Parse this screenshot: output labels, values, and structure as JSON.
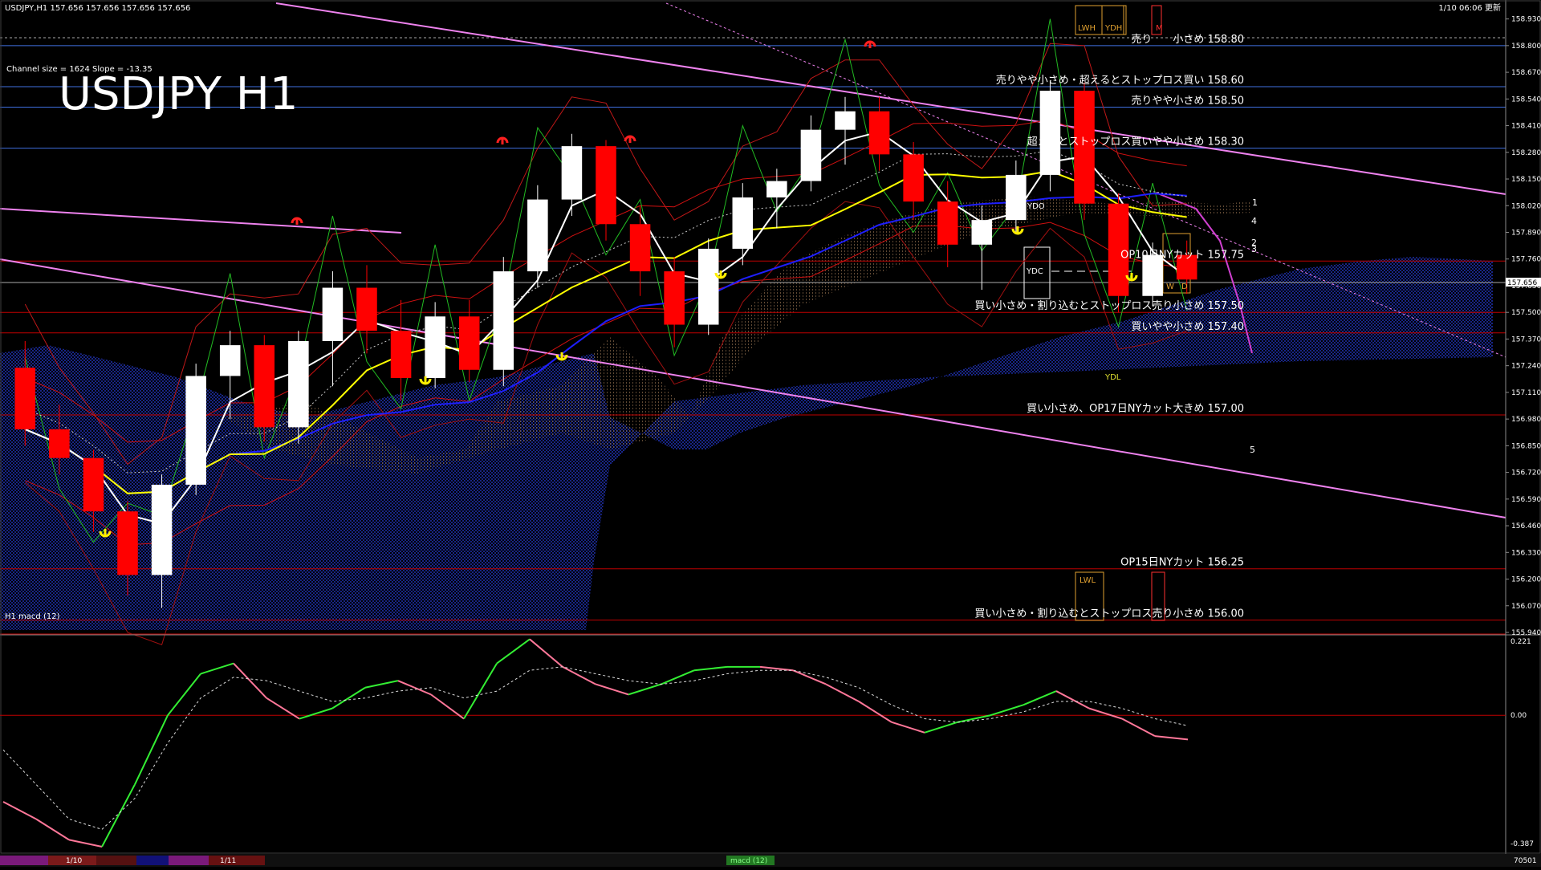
{
  "chart_header": "USDJPY,H1  157.656 157.656 157.656 157.656",
  "channel_info": "Channel size = 1624 Slope = -13.35",
  "big_title": "USDJPY H1",
  "update_time": "1/10 06:06 更新",
  "current_price": "157.656",
  "colors": {
    "background": "#000000",
    "bull_candle": "#ffffff",
    "bear_candle": "#ff0000",
    "ma_short": "#ffffff",
    "ma_mid": "#ffff00",
    "ma_long": "#1e1eff",
    "channel": "#ee82ee",
    "level_blue": "#3f6fdf",
    "level_red": "#c00000",
    "cloud_blue": "#1c2c9c",
    "cloud_brown": "#8a6a4a",
    "macd_up": "#33ee33",
    "macd_down": "#ff7799"
  },
  "annotations": [
    {
      "text": "売り　　小さめ 158.80",
      "price": 158.8
    },
    {
      "text": "売りやや小さめ・超えるとストップロス買い 158.60",
      "price": 158.6
    },
    {
      "text": "売りやや小さめ 158.50",
      "price": 158.5
    },
    {
      "text": "超えるとストップロス買いやや小さめ 158.30",
      "price": 158.3
    },
    {
      "text": "OP10日NYカット 157.75",
      "price": 157.75
    },
    {
      "text": "買い小さめ・割り込むとストップロス売り小さめ 157.50",
      "price": 157.5
    },
    {
      "text": "買いやや小さめ 157.40",
      "price": 157.4
    },
    {
      "text": "買い小さめ、OP17日NYカット大きめ 157.00",
      "price": 157.0
    },
    {
      "text": "OP15日NYカット 156.25",
      "price": 156.25
    },
    {
      "text": "買い小さめ・割り込むとストップロス売り小さめ 156.00",
      "price": 156.0
    }
  ],
  "box_labels": {
    "lwh": "LWH",
    "ydh": "YDH",
    "m": "M",
    "ydo": "YDO",
    "ydc": "YDC",
    "w": "W",
    "d": "D",
    "ydl": "YDL",
    "lwl": "LWL"
  },
  "channel_labels": [
    "1",
    "2",
    "3",
    "4",
    "5"
  ],
  "macd_label": "H1  macd (12)",
  "macd_axis": [
    "0.221",
    "0.00",
    "-0.387"
  ],
  "bottom_ticks": [
    "1/10",
    "1/11"
  ],
  "bottom_right": "70501",
  "bottom_tab": "macd (12)",
  "chart_data": [
    {
      "type": "candlestick",
      "title": "USDJPY H1",
      "ylim": [
        155.94,
        158.995
      ],
      "y_ticks": [
        "158.930",
        "158.800",
        "158.670",
        "158.540",
        "158.410",
        "158.280",
        "158.150",
        "158.020",
        "157.890",
        "157.760",
        "157.630",
        "157.500",
        "157.370",
        "157.240",
        "157.110",
        "156.980",
        "156.850",
        "156.720",
        "156.590",
        "156.460",
        "156.330",
        "156.200",
        "156.070",
        "155.940"
      ],
      "horizontal_levels": [
        158.8,
        158.6,
        158.5,
        158.3,
        157.75,
        157.5,
        157.4,
        157.0,
        156.25,
        156.0
      ],
      "candles_count": 178,
      "ohlc": [
        {
          "o": 157.23,
          "h": 157.36,
          "l": 156.85,
          "c": 156.93
        },
        {
          "o": 156.93,
          "h": 157.05,
          "l": 156.71,
          "c": 156.79
        },
        {
          "o": 156.79,
          "h": 156.83,
          "l": 156.43,
          "c": 156.53
        },
        {
          "o": 156.53,
          "h": 156.58,
          "l": 156.12,
          "c": 156.22
        },
        {
          "o": 156.22,
          "h": 156.71,
          "l": 156.06,
          "c": 156.66
        },
        {
          "o": 156.66,
          "h": 157.25,
          "l": 156.61,
          "c": 157.19
        },
        {
          "o": 157.19,
          "h": 157.41,
          "l": 156.98,
          "c": 157.34
        },
        {
          "o": 157.34,
          "h": 157.39,
          "l": 156.87,
          "c": 156.94
        },
        {
          "o": 156.94,
          "h": 157.41,
          "l": 156.86,
          "c": 157.36
        },
        {
          "o": 157.36,
          "h": 157.7,
          "l": 157.14,
          "c": 157.62
        },
        {
          "o": 157.62,
          "h": 157.73,
          "l": 157.3,
          "c": 157.41
        },
        {
          "o": 157.41,
          "h": 157.56,
          "l": 157.07,
          "c": 157.18
        },
        {
          "o": 157.18,
          "h": 157.55,
          "l": 157.13,
          "c": 157.48
        },
        {
          "o": 157.48,
          "h": 157.56,
          "l": 157.16,
          "c": 157.22
        },
        {
          "o": 157.22,
          "h": 157.77,
          "l": 157.14,
          "c": 157.7
        },
        {
          "o": 157.7,
          "h": 158.12,
          "l": 157.62,
          "c": 158.05
        },
        {
          "o": 158.05,
          "h": 158.37,
          "l": 157.97,
          "c": 158.31
        },
        {
          "o": 158.31,
          "h": 158.34,
          "l": 157.85,
          "c": 157.93
        },
        {
          "o": 157.93,
          "h": 158.02,
          "l": 157.58,
          "c": 157.7
        },
        {
          "o": 157.7,
          "h": 157.77,
          "l": 157.33,
          "c": 157.44
        },
        {
          "o": 157.44,
          "h": 157.86,
          "l": 157.39,
          "c": 157.81
        },
        {
          "o": 157.81,
          "h": 158.13,
          "l": 157.73,
          "c": 158.06
        },
        {
          "o": 158.06,
          "h": 158.2,
          "l": 157.91,
          "c": 158.14
        },
        {
          "o": 158.14,
          "h": 158.46,
          "l": 158.09,
          "c": 158.39
        },
        {
          "o": 158.39,
          "h": 158.55,
          "l": 158.22,
          "c": 158.48
        },
        {
          "o": 158.48,
          "h": 158.55,
          "l": 158.19,
          "c": 158.27
        },
        {
          "o": 158.27,
          "h": 158.33,
          "l": 157.95,
          "c": 158.04
        },
        {
          "o": 158.04,
          "h": 158.14,
          "l": 157.72,
          "c": 157.83
        },
        {
          "o": 157.83,
          "h": 158.02,
          "l": 157.61,
          "c": 157.95
        },
        {
          "o": 157.95,
          "h": 158.24,
          "l": 157.88,
          "c": 158.17
        },
        {
          "o": 158.17,
          "h": 158.63,
          "l": 158.09,
          "c": 158.58
        },
        {
          "o": 158.58,
          "h": 158.62,
          "l": 157.95,
          "c": 158.03
        },
        {
          "o": 158.03,
          "h": 158.08,
          "l": 157.5,
          "c": 157.58
        },
        {
          "o": 157.58,
          "h": 157.84,
          "l": 157.53,
          "c": 157.78
        },
        {
          "o": 157.78,
          "h": 157.85,
          "l": 157.59,
          "c": 157.66
        }
      ]
    },
    {
      "type": "line",
      "title": "macd (12)",
      "ylim": [
        -0.387,
        0.221
      ],
      "series": [
        {
          "values": [
            -0.25,
            -0.3,
            -0.36,
            -0.38,
            -0.2,
            0.0,
            0.12,
            0.15,
            0.05,
            -0.01,
            0.02,
            0.08,
            0.1,
            0.06,
            -0.01,
            0.15,
            0.22,
            0.14,
            0.09,
            0.06,
            0.09,
            0.13,
            0.14,
            0.14,
            0.13,
            0.09,
            0.04,
            -0.02,
            -0.05,
            -0.02,
            0.0,
            0.03,
            0.07,
            0.02,
            -0.01,
            -0.06,
            -0.07
          ]
        },
        {
          "values": [
            -0.1,
            -0.2,
            -0.3,
            -0.33,
            -0.24,
            -0.08,
            0.05,
            0.11,
            0.1,
            0.07,
            0.04,
            0.05,
            0.07,
            0.08,
            0.05,
            0.07,
            0.13,
            0.14,
            0.12,
            0.1,
            0.09,
            0.1,
            0.12,
            0.13,
            0.13,
            0.11,
            0.08,
            0.03,
            -0.01,
            -0.02,
            -0.01,
            0.01,
            0.04,
            0.04,
            0.02,
            -0.01,
            -0.03
          ]
        }
      ]
    }
  ]
}
